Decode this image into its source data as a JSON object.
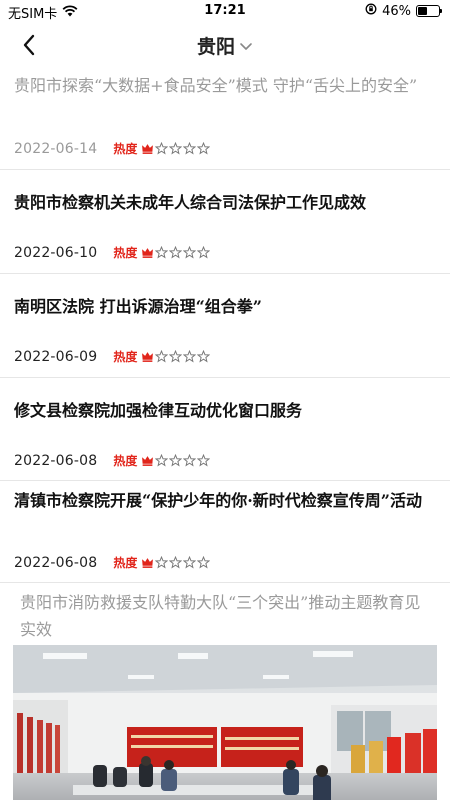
{
  "status_bar": {
    "carrier": "无SIM卡",
    "time": "17:21",
    "battery": "46%",
    "battery_level": 0.46
  },
  "nav": {
    "title": "贵阳"
  },
  "articles": [
    {
      "title": "贵阳市探索“大数据+食品安全”模式 守护“舌尖上的安全”",
      "date": "2022-06-14",
      "hot_label": "热度",
      "heat_level": 1,
      "heat_max": 5
    },
    {
      "title": "贵阳市检察机关未成年人综合司法保护工作见成效",
      "date": "2022-06-10",
      "hot_label": "热度",
      "heat_level": 1,
      "heat_max": 5
    },
    {
      "title": "南明区法院 打出诉源治理“组合拳”",
      "date": "2022-06-09",
      "hot_label": "热度",
      "heat_level": 1,
      "heat_max": 5
    },
    {
      "title": "修文县检察院加强检律互动优化窗口服务",
      "date": "2022-06-08",
      "hot_label": "热度",
      "heat_level": 1,
      "heat_max": 5
    },
    {
      "title": "清镇市检察院开展“保护少年的你·新时代检察宣传周”活动",
      "date": "2022-06-08",
      "hot_label": "热度",
      "heat_level": 1,
      "heat_max": 5
    },
    {
      "title": "贵阳市消防救援支队特勤大队“三个突出”推动主题教育见实效"
    }
  ],
  "colors": {
    "accent_red": "#e1251b",
    "divider": "#e6e6e6"
  },
  "icons": {
    "back": "chevron-left-icon",
    "dropdown": "chevron-down-icon",
    "crown": "crown-icon",
    "star": "star-outline-icon"
  }
}
